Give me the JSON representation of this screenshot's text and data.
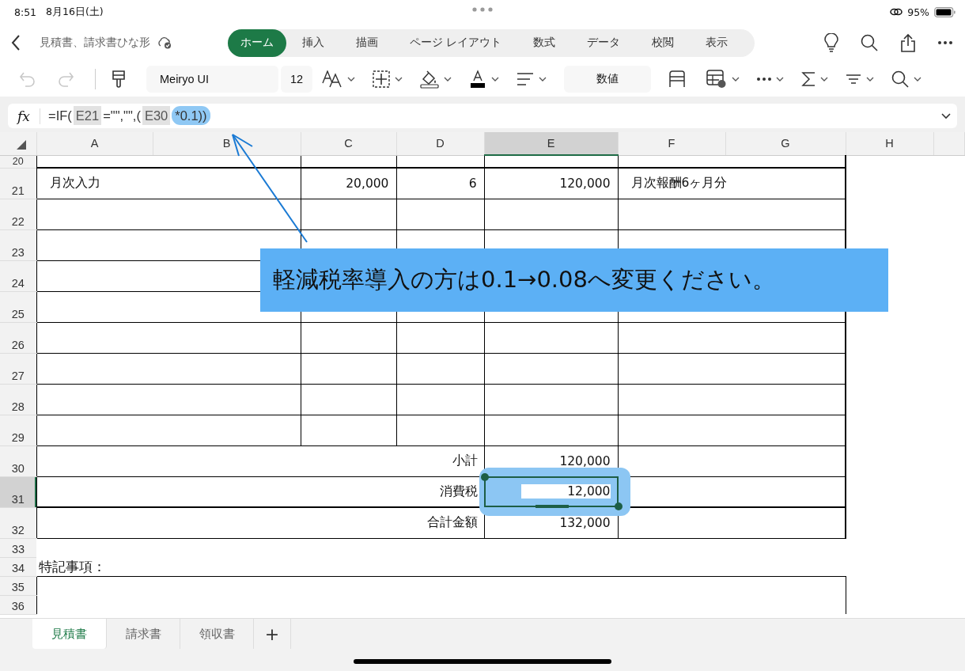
{
  "status_bar": {
    "time": "8:51",
    "date": "8月16日(土)",
    "battery": "95%"
  },
  "document": {
    "title": "見積書、請求書ひな形"
  },
  "tabs": [
    {
      "label": "ホーム",
      "selected": true
    },
    {
      "label": "挿入",
      "selected": false
    },
    {
      "label": "描画",
      "selected": false
    },
    {
      "label": "ページ レイアウト",
      "selected": false
    },
    {
      "label": "数式",
      "selected": false
    },
    {
      "label": "データ",
      "selected": false
    },
    {
      "label": "校閲",
      "selected": false
    },
    {
      "label": "表示",
      "selected": false
    }
  ],
  "toolbar": {
    "font": "Meiryo UI",
    "font_size": "12",
    "number_format": "数値"
  },
  "formula_bar": {
    "label": "fx",
    "parts": [
      {
        "kind": "plain",
        "text": "=IF("
      },
      {
        "kind": "ref",
        "text": "E21"
      },
      {
        "kind": "plain",
        "text": "=\"\",\"\",("
      },
      {
        "kind": "ref",
        "text": "E30"
      },
      {
        "kind": "highlight",
        "text": "*0.1))"
      }
    ]
  },
  "columns": [
    {
      "label": "A",
      "selected": false
    },
    {
      "label": "B",
      "selected": false
    },
    {
      "label": "C",
      "selected": false
    },
    {
      "label": "D",
      "selected": false
    },
    {
      "label": "E",
      "selected": true
    },
    {
      "label": "F",
      "selected": false
    },
    {
      "label": "G",
      "selected": false
    },
    {
      "label": "H",
      "selected": false
    }
  ],
  "rows": [
    {
      "num": "20",
      "kind": "top",
      "selected": false
    },
    {
      "num": "21",
      "kind": "item",
      "selected": false,
      "cells": [
        "月次入力",
        "20,000",
        "6",
        "120,000",
        "月次報酬6ヶ月分"
      ]
    },
    {
      "num": "22",
      "kind": "item",
      "selected": false
    },
    {
      "num": "23",
      "kind": "item",
      "selected": false
    },
    {
      "num": "24",
      "kind": "item",
      "selected": false
    },
    {
      "num": "25",
      "kind": "item",
      "selected": false
    },
    {
      "num": "26",
      "kind": "item",
      "selected": false
    },
    {
      "num": "27",
      "kind": "item",
      "selected": false
    },
    {
      "num": "28",
      "kind": "item",
      "selected": false
    },
    {
      "num": "29",
      "kind": "item",
      "selected": false
    },
    {
      "num": "30",
      "kind": "total",
      "selected": false,
      "label": "小計",
      "value": "120,000"
    },
    {
      "num": "31",
      "kind": "total",
      "selected": true,
      "label": "消費税",
      "value": "12,000"
    },
    {
      "num": "32",
      "kind": "total",
      "selected": false,
      "label": "合計金額",
      "value": "132,000"
    },
    {
      "num": "33",
      "kind": "blank",
      "selected": false
    },
    {
      "num": "34",
      "kind": "note",
      "selected": false,
      "label": "特記事項："
    },
    {
      "num": "35",
      "kind": "notebox",
      "selected": false
    },
    {
      "num": "36",
      "kind": "notebox",
      "selected": false
    }
  ],
  "callout": {
    "text": "軽減税率導入の方は0.1→0.08へ変更ください。"
  },
  "sheet_tabs": [
    {
      "label": "見積書",
      "selected": true
    },
    {
      "label": "請求書",
      "selected": false
    },
    {
      "label": "領収書",
      "selected": false
    }
  ],
  "add_sheet": "+"
}
